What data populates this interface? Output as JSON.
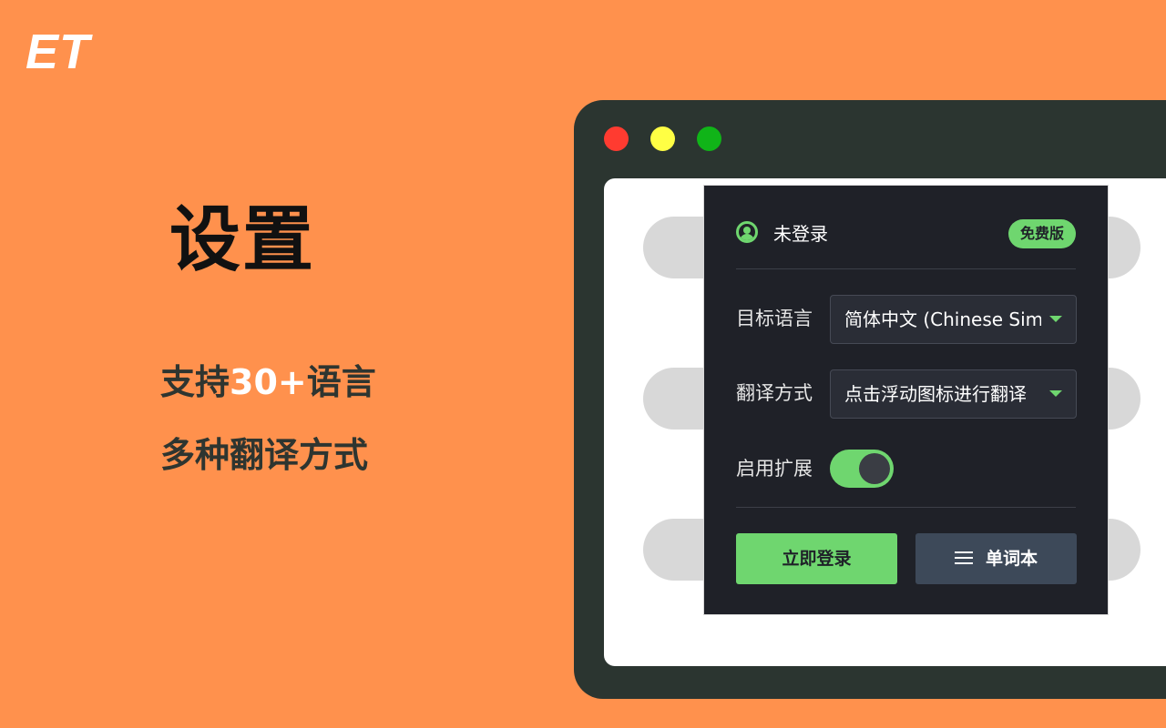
{
  "logo": {
    "text": "ET"
  },
  "hero": {
    "title": "设置",
    "features": [
      {
        "pre": "支持",
        "highlight": "30+",
        "post": "语言"
      },
      {
        "text": "多种翻译方式"
      }
    ]
  },
  "popup": {
    "user_label": "未登录",
    "plan_badge": "免费版",
    "target_language": {
      "label": "目标语言",
      "value": "简体中文 (Chinese Simplified)"
    },
    "translation_mode": {
      "label": "翻译方式",
      "value": "点击浮动图标进行翻译"
    },
    "enable_extension": {
      "label": "启用扩展",
      "enabled": true
    },
    "login_button": "立即登录",
    "wordbook_button": "单词本"
  },
  "colors": {
    "background": "#FF914D",
    "accent": "#6FD66F",
    "window": "#2B3530",
    "popup": "#1F2128",
    "secondary_button": "#3D4959"
  }
}
